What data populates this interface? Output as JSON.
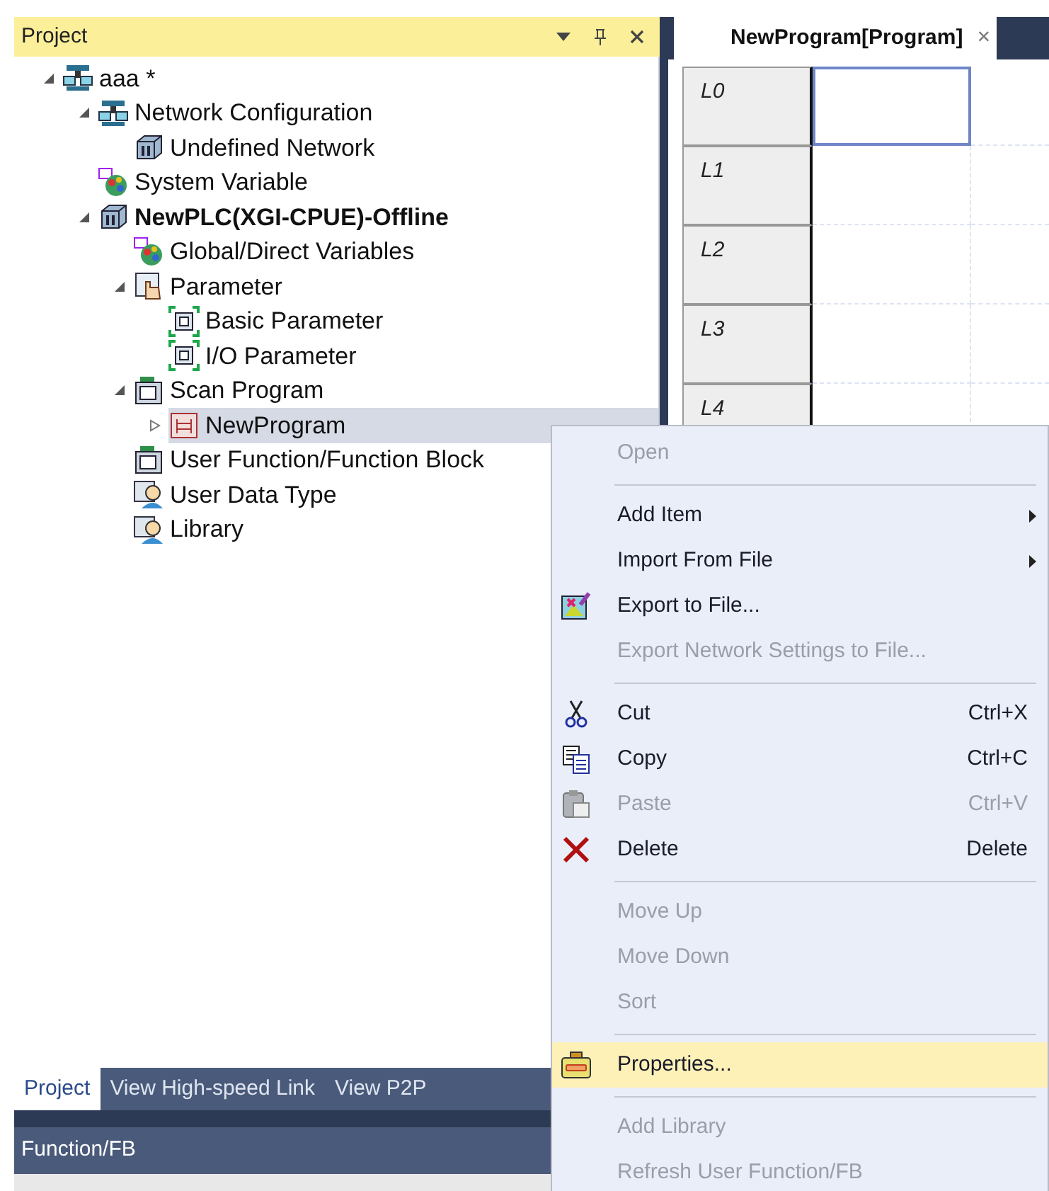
{
  "project_panel": {
    "title": "Project",
    "tree": [
      {
        "label": "aaa *",
        "kind": "network",
        "expanded": true,
        "selected": false,
        "active": false,
        "children": [
          {
            "label": "Network Configuration",
            "kind": "network",
            "expanded": true,
            "selected": false,
            "active": false,
            "children": [
              {
                "label": "Undefined Network",
                "kind": "module",
                "selected": false,
                "active": false
              }
            ]
          },
          {
            "label": "System Variable",
            "kind": "variable",
            "selected": false,
            "active": false
          },
          {
            "label": "NewPLC(XGI-CPUE)-Offline",
            "kind": "module",
            "expanded": true,
            "selected": false,
            "active": true,
            "children": [
              {
                "label": "Global/Direct Variables",
                "kind": "variable",
                "selected": false,
                "active": false
              },
              {
                "label": "Parameter",
                "kind": "parameter",
                "expanded": true,
                "selected": false,
                "active": false,
                "children": [
                  {
                    "label": "Basic Parameter",
                    "kind": "setting",
                    "selected": false,
                    "active": false
                  },
                  {
                    "label": "I/O Parameter",
                    "kind": "setting",
                    "selected": false,
                    "active": false
                  }
                ]
              },
              {
                "label": "Scan Program",
                "kind": "program",
                "expanded": true,
                "selected": false,
                "active": false,
                "children": [
                  {
                    "label": "NewProgram",
                    "kind": "ladder",
                    "expanded": false,
                    "selected": true,
                    "active": false
                  }
                ]
              },
              {
                "label": "User Function/Function Block",
                "kind": "program",
                "selected": false,
                "active": false
              },
              {
                "label": "User Data Type",
                "kind": "person",
                "selected": false,
                "active": false
              },
              {
                "label": "Library",
                "kind": "person",
                "selected": false,
                "active": false
              }
            ]
          }
        ]
      }
    ],
    "tabs": [
      {
        "label": "Project",
        "selected": true
      },
      {
        "label": "View High-speed Link",
        "selected": false
      },
      {
        "label": "View P2P",
        "selected": false
      }
    ]
  },
  "function_panel": {
    "title": "Function/FB"
  },
  "editor": {
    "tab": {
      "label": "NewProgram[Program]",
      "close": "×"
    },
    "rungs": [
      {
        "label": "L0",
        "selected": true
      },
      {
        "label": "L1",
        "selected": false
      },
      {
        "label": "L2",
        "selected": false
      },
      {
        "label": "L3",
        "selected": false
      },
      {
        "label": "L4",
        "selected": false
      }
    ]
  },
  "context_menu": [
    {
      "kind": "command",
      "label": "Open",
      "disabled": true,
      "selected": false
    },
    {
      "kind": "separator"
    },
    {
      "kind": "command",
      "label": "Add Item",
      "disabled": false,
      "submenu": true,
      "selected": false
    },
    {
      "kind": "command",
      "label": "Import From File",
      "disabled": false,
      "submenu": true,
      "selected": false
    },
    {
      "kind": "export",
      "label": "Export to File...",
      "disabled": false,
      "selected": false
    },
    {
      "kind": "command",
      "label": "Export Network Settings to File...",
      "disabled": true,
      "selected": false
    },
    {
      "kind": "separator"
    },
    {
      "kind": "cut",
      "label": "Cut",
      "shortcut": "Ctrl+X",
      "disabled": false,
      "selected": false
    },
    {
      "kind": "copy",
      "label": "Copy",
      "shortcut": "Ctrl+C",
      "disabled": false,
      "selected": false
    },
    {
      "kind": "paste",
      "label": "Paste",
      "shortcut": "Ctrl+V",
      "disabled": true,
      "selected": false
    },
    {
      "kind": "delete",
      "label": "Delete",
      "shortcut": "Delete",
      "disabled": false,
      "selected": false
    },
    {
      "kind": "separator"
    },
    {
      "kind": "command",
      "label": "Move Up",
      "disabled": true,
      "selected": false
    },
    {
      "kind": "command",
      "label": "Move Down",
      "disabled": true,
      "selected": false
    },
    {
      "kind": "command",
      "label": "Sort",
      "disabled": true,
      "selected": false
    },
    {
      "kind": "separator"
    },
    {
      "kind": "properties",
      "label": "Properties...",
      "disabled": false,
      "selected": true
    },
    {
      "kind": "separator"
    },
    {
      "kind": "command",
      "label": "Add Library",
      "disabled": true,
      "selected": false
    },
    {
      "kind": "command",
      "label": "Refresh User Function/FB",
      "disabled": true,
      "selected": false
    }
  ]
}
